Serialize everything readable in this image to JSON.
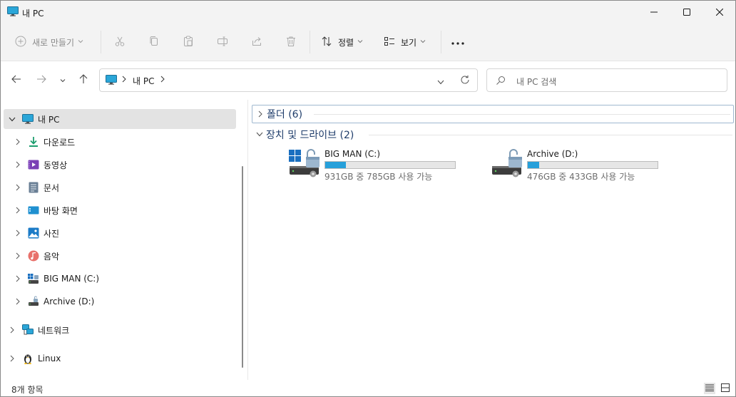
{
  "window": {
    "title": "내 PC",
    "colors": {
      "accent": "#26a0da",
      "title_bg": "#f3f3f3",
      "selected_bg": "#e3e3e3"
    }
  },
  "toolbar": {
    "new_label": "새로 만들기",
    "sort_label": "정렬",
    "view_label": "보기",
    "icons": [
      "plus-icon",
      "cut-icon",
      "copy-icon",
      "paste-icon",
      "rename-icon",
      "share-icon",
      "delete-icon",
      "sort-icon",
      "view-icon",
      "more-icon"
    ]
  },
  "address": {
    "crumbs": [
      "내 PC"
    ]
  },
  "search": {
    "placeholder": "내 PC 검색"
  },
  "nav": {
    "root": "내 PC",
    "items": [
      {
        "label": "다운로드",
        "icon": "download-icon"
      },
      {
        "label": "동영상",
        "icon": "video-icon"
      },
      {
        "label": "문서",
        "icon": "document-icon"
      },
      {
        "label": "바탕 화면",
        "icon": "desktop-icon"
      },
      {
        "label": "사진",
        "icon": "pictures-icon"
      },
      {
        "label": "음악",
        "icon": "music-icon"
      },
      {
        "label": "BIG MAN (C:)",
        "icon": "windows-drive-icon"
      },
      {
        "label": "Archive (D:)",
        "icon": "drive-icon"
      }
    ],
    "network": "네트워크",
    "linux": "Linux"
  },
  "content": {
    "folders_group": "폴더 (6)",
    "devices_group": "장치 및 드라이브 (2)",
    "drives": [
      {
        "name": "BIG MAN (C:)",
        "free_text": "931GB 중 785GB 사용 가능",
        "used_fraction": 0.157,
        "icon": "locked-windows-drive-icon"
      },
      {
        "name": "Archive (D:)",
        "free_text": "476GB 중 433GB 사용 가능",
        "used_fraction": 0.09,
        "icon": "locked-drive-icon"
      }
    ]
  },
  "status": {
    "count_text": "8개 항목"
  }
}
